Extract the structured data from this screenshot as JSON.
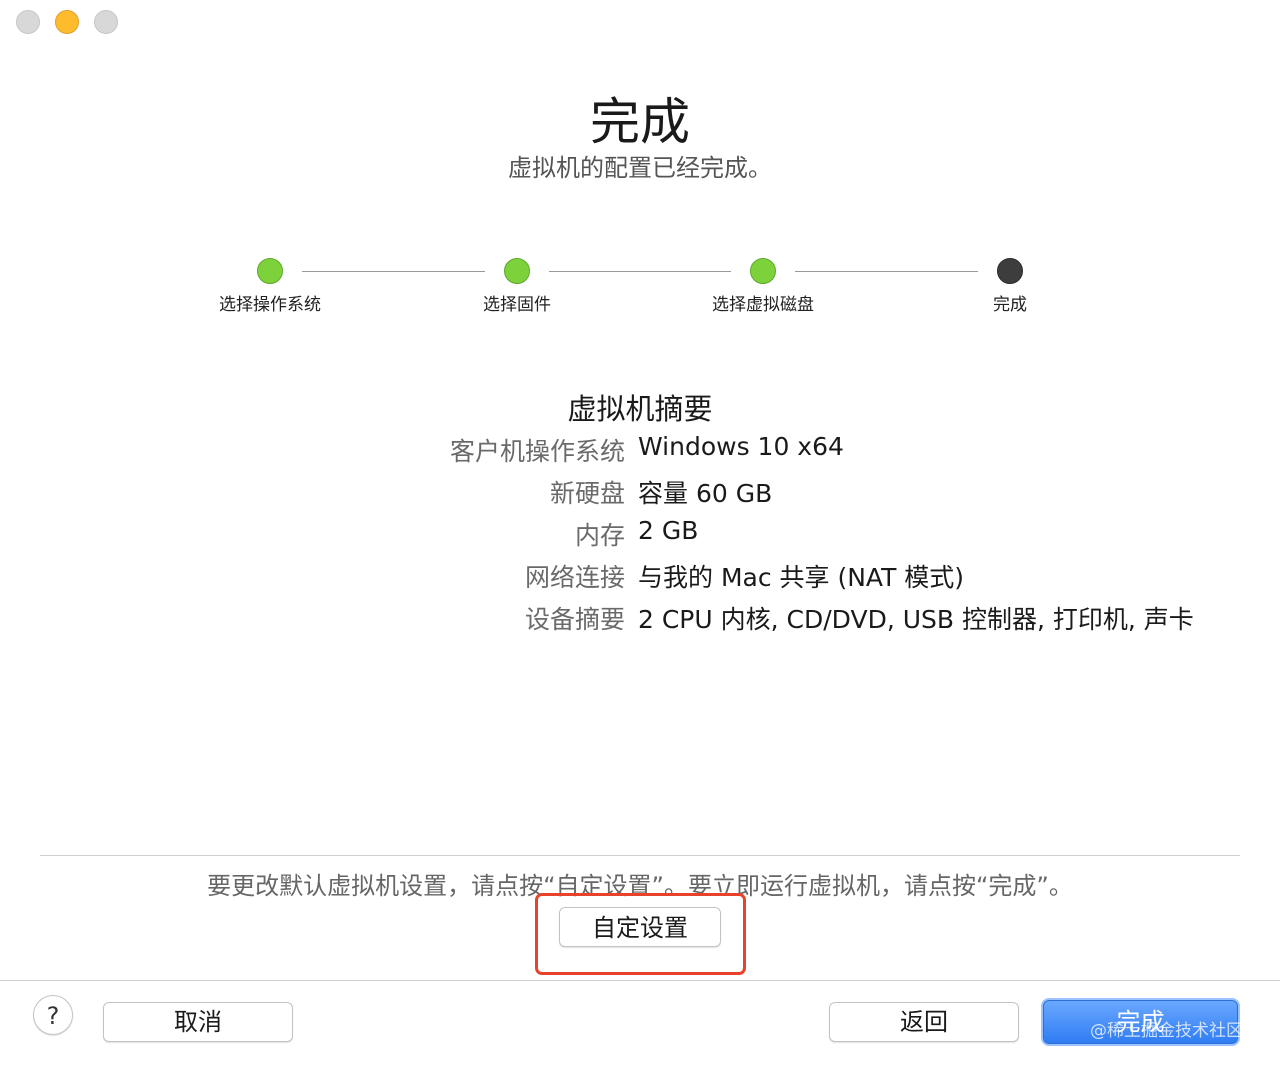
{
  "window": {
    "title": "完成",
    "subtitle": "虚拟机的配置已经完成。"
  },
  "steps": [
    {
      "label": "选择操作系统",
      "status": "done"
    },
    {
      "label": "选择固件",
      "status": "done"
    },
    {
      "label": "选择虚拟磁盘",
      "status": "done"
    },
    {
      "label": "完成",
      "status": "current"
    }
  ],
  "summary": {
    "title": "虚拟机摘要",
    "rows": [
      {
        "label": "客户机操作系统",
        "value": "Windows 10 x64"
      },
      {
        "label": "新硬盘",
        "value": "容量 60 GB"
      },
      {
        "label": "内存",
        "value": "2 GB"
      },
      {
        "label": "网络连接",
        "value": "与我的 Mac 共享 (NAT 模式)"
      },
      {
        "label": "设备摘要",
        "value": "2 CPU 内核, CD/DVD, USB 控制器, 打印机, 声卡"
      }
    ]
  },
  "hint": "要更改默认虚拟机设置，请点按“自定设置”。要立即运行虚拟机，请点按“完成”。",
  "buttons": {
    "customize": "自定设置",
    "help": "?",
    "cancel": "取消",
    "back": "返回",
    "finish": "完成"
  },
  "watermark": "@稀土掘金技术社区",
  "colors": {
    "step_done": "#7dd23c",
    "step_current": "#3d3d3d",
    "primary_button": "#2f7cf3",
    "highlight_box": "#e8432a"
  }
}
